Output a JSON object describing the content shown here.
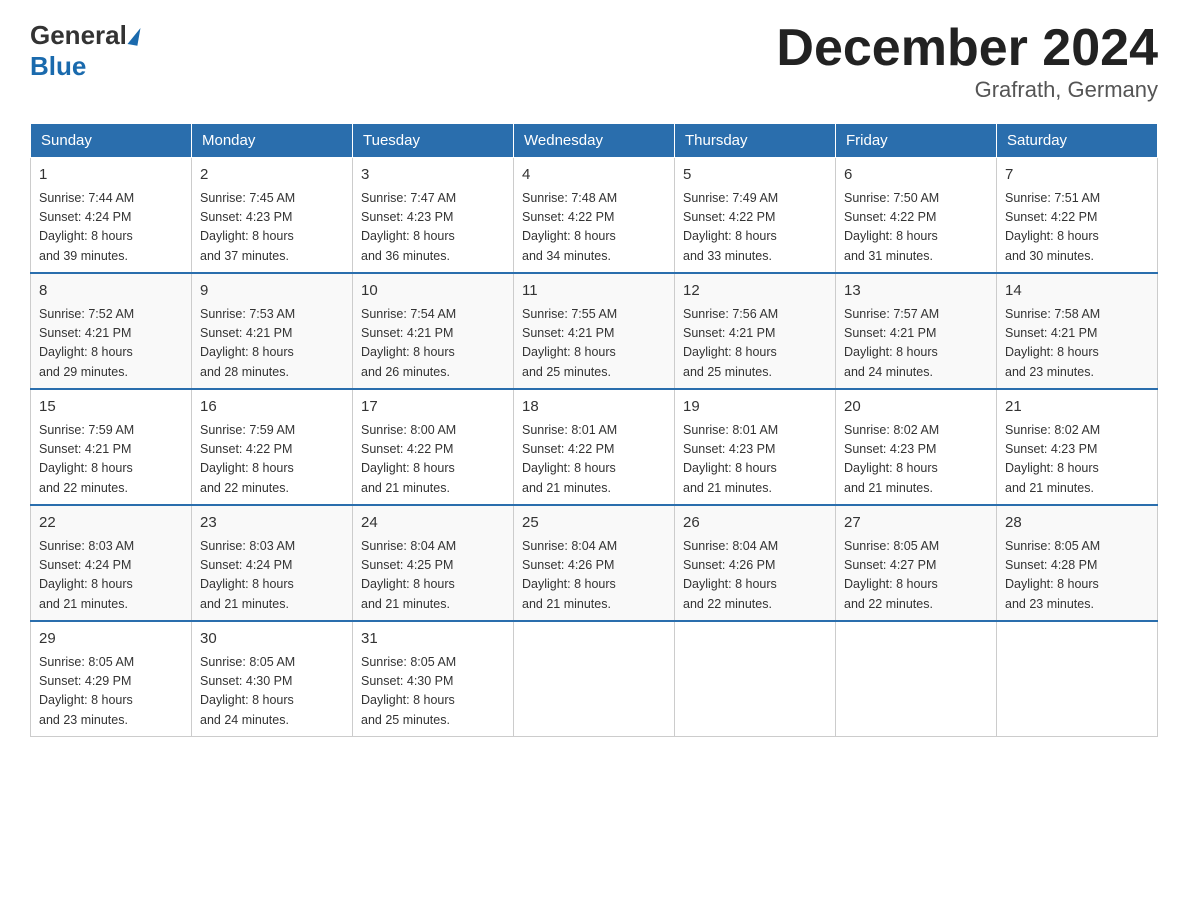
{
  "header": {
    "logo_general": "General",
    "logo_blue": "Blue",
    "month_title": "December 2024",
    "subtitle": "Grafrath, Germany"
  },
  "days_of_week": [
    "Sunday",
    "Monday",
    "Tuesday",
    "Wednesday",
    "Thursday",
    "Friday",
    "Saturday"
  ],
  "weeks": [
    [
      {
        "day": "1",
        "sunrise": "7:44 AM",
        "sunset": "4:24 PM",
        "daylight": "8 hours and 39 minutes."
      },
      {
        "day": "2",
        "sunrise": "7:45 AM",
        "sunset": "4:23 PM",
        "daylight": "8 hours and 37 minutes."
      },
      {
        "day": "3",
        "sunrise": "7:47 AM",
        "sunset": "4:23 PM",
        "daylight": "8 hours and 36 minutes."
      },
      {
        "day": "4",
        "sunrise": "7:48 AM",
        "sunset": "4:22 PM",
        "daylight": "8 hours and 34 minutes."
      },
      {
        "day": "5",
        "sunrise": "7:49 AM",
        "sunset": "4:22 PM",
        "daylight": "8 hours and 33 minutes."
      },
      {
        "day": "6",
        "sunrise": "7:50 AM",
        "sunset": "4:22 PM",
        "daylight": "8 hours and 31 minutes."
      },
      {
        "day": "7",
        "sunrise": "7:51 AM",
        "sunset": "4:22 PM",
        "daylight": "8 hours and 30 minutes."
      }
    ],
    [
      {
        "day": "8",
        "sunrise": "7:52 AM",
        "sunset": "4:21 PM",
        "daylight": "8 hours and 29 minutes."
      },
      {
        "day": "9",
        "sunrise": "7:53 AM",
        "sunset": "4:21 PM",
        "daylight": "8 hours and 28 minutes."
      },
      {
        "day": "10",
        "sunrise": "7:54 AM",
        "sunset": "4:21 PM",
        "daylight": "8 hours and 26 minutes."
      },
      {
        "day": "11",
        "sunrise": "7:55 AM",
        "sunset": "4:21 PM",
        "daylight": "8 hours and 25 minutes."
      },
      {
        "day": "12",
        "sunrise": "7:56 AM",
        "sunset": "4:21 PM",
        "daylight": "8 hours and 25 minutes."
      },
      {
        "day": "13",
        "sunrise": "7:57 AM",
        "sunset": "4:21 PM",
        "daylight": "8 hours and 24 minutes."
      },
      {
        "day": "14",
        "sunrise": "7:58 AM",
        "sunset": "4:21 PM",
        "daylight": "8 hours and 23 minutes."
      }
    ],
    [
      {
        "day": "15",
        "sunrise": "7:59 AM",
        "sunset": "4:21 PM",
        "daylight": "8 hours and 22 minutes."
      },
      {
        "day": "16",
        "sunrise": "7:59 AM",
        "sunset": "4:22 PM",
        "daylight": "8 hours and 22 minutes."
      },
      {
        "day": "17",
        "sunrise": "8:00 AM",
        "sunset": "4:22 PM",
        "daylight": "8 hours and 21 minutes."
      },
      {
        "day": "18",
        "sunrise": "8:01 AM",
        "sunset": "4:22 PM",
        "daylight": "8 hours and 21 minutes."
      },
      {
        "day": "19",
        "sunrise": "8:01 AM",
        "sunset": "4:23 PM",
        "daylight": "8 hours and 21 minutes."
      },
      {
        "day": "20",
        "sunrise": "8:02 AM",
        "sunset": "4:23 PM",
        "daylight": "8 hours and 21 minutes."
      },
      {
        "day": "21",
        "sunrise": "8:02 AM",
        "sunset": "4:23 PM",
        "daylight": "8 hours and 21 minutes."
      }
    ],
    [
      {
        "day": "22",
        "sunrise": "8:03 AM",
        "sunset": "4:24 PM",
        "daylight": "8 hours and 21 minutes."
      },
      {
        "day": "23",
        "sunrise": "8:03 AM",
        "sunset": "4:24 PM",
        "daylight": "8 hours and 21 minutes."
      },
      {
        "day": "24",
        "sunrise": "8:04 AM",
        "sunset": "4:25 PM",
        "daylight": "8 hours and 21 minutes."
      },
      {
        "day": "25",
        "sunrise": "8:04 AM",
        "sunset": "4:26 PM",
        "daylight": "8 hours and 21 minutes."
      },
      {
        "day": "26",
        "sunrise": "8:04 AM",
        "sunset": "4:26 PM",
        "daylight": "8 hours and 22 minutes."
      },
      {
        "day": "27",
        "sunrise": "8:05 AM",
        "sunset": "4:27 PM",
        "daylight": "8 hours and 22 minutes."
      },
      {
        "day": "28",
        "sunrise": "8:05 AM",
        "sunset": "4:28 PM",
        "daylight": "8 hours and 23 minutes."
      }
    ],
    [
      {
        "day": "29",
        "sunrise": "8:05 AM",
        "sunset": "4:29 PM",
        "daylight": "8 hours and 23 minutes."
      },
      {
        "day": "30",
        "sunrise": "8:05 AM",
        "sunset": "4:30 PM",
        "daylight": "8 hours and 24 minutes."
      },
      {
        "day": "31",
        "sunrise": "8:05 AM",
        "sunset": "4:30 PM",
        "daylight": "8 hours and 25 minutes."
      },
      null,
      null,
      null,
      null
    ]
  ],
  "labels": {
    "sunrise": "Sunrise:",
    "sunset": "Sunset:",
    "daylight": "Daylight:"
  }
}
